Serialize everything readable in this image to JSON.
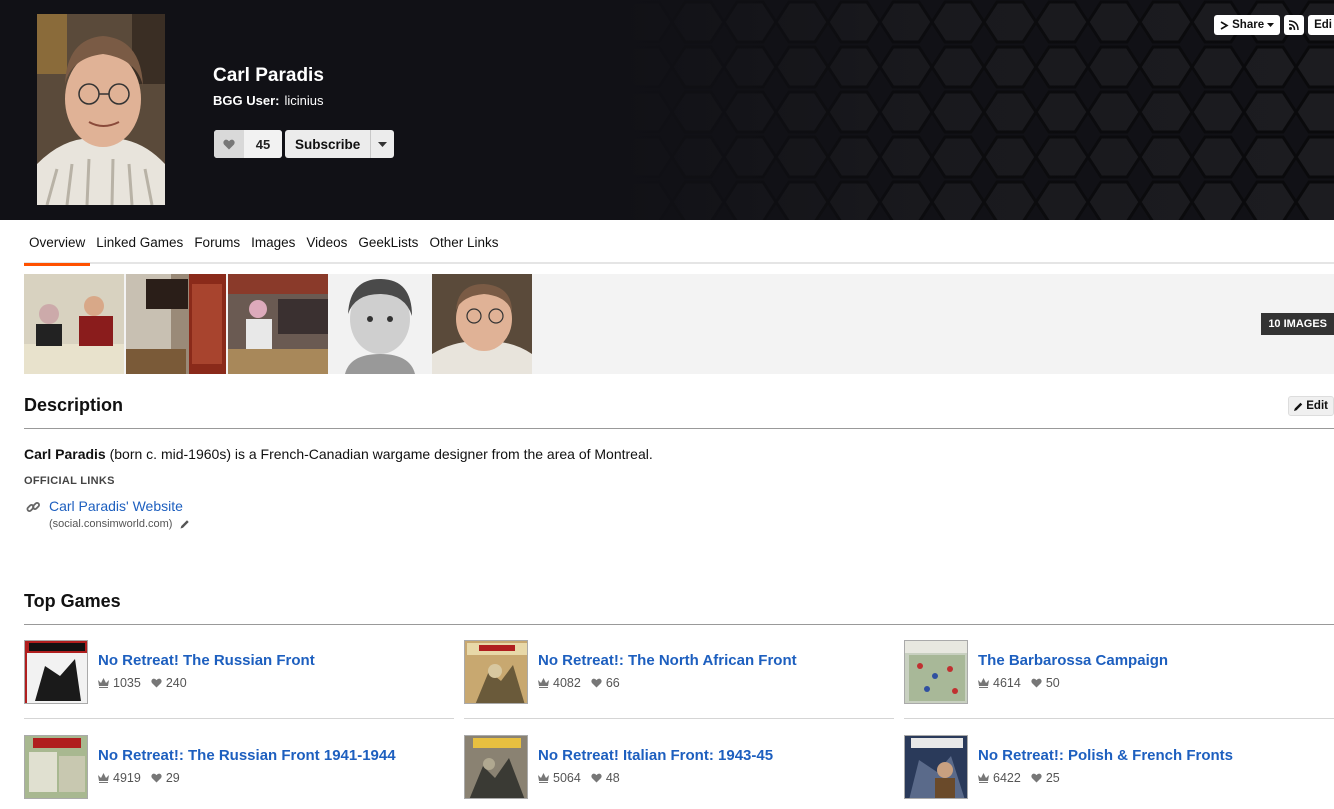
{
  "header": {
    "name": "Carl Paradis",
    "user_label": "BGG User:",
    "username": "licinius",
    "fan_count": "45",
    "subscribe_label": "Subscribe",
    "share_label": "Share",
    "edit_label": "Edi"
  },
  "tabs": [
    "Overview",
    "Linked Games",
    "Forums",
    "Images",
    "Videos",
    "GeekLists",
    "Other Links"
  ],
  "gallery": {
    "count_label": "10 IMAGES"
  },
  "description": {
    "title": "Description",
    "edit_label": "Edit",
    "name_bold": "Carl Paradis",
    "text": " (born c. mid-1960s) is a French-Canadian wargame designer from the area of Montreal.",
    "official_links_label": "OFFICIAL LINKS",
    "link_text": "Carl Paradis' Website",
    "link_domain": "(social.consimworld.com)"
  },
  "top_games": {
    "title": "Top Games",
    "games": [
      {
        "title": "No Retreat! The Russian Front",
        "rank": "1035",
        "fans": "240"
      },
      {
        "title": "No Retreat!: The North African Front",
        "rank": "4082",
        "fans": "66"
      },
      {
        "title": "The Barbarossa Campaign",
        "rank": "4614",
        "fans": "50"
      },
      {
        "title": "No Retreat!: The Russian Front 1941-1944",
        "rank": "4919",
        "fans": "29"
      },
      {
        "title": "No Retreat! Italian Front: 1943-45",
        "rank": "5064",
        "fans": "48"
      },
      {
        "title": "No Retreat!: Polish & French Fronts",
        "rank": "6422",
        "fans": "25"
      }
    ]
  },
  "colors": {
    "accent": "#ff5100",
    "link": "#1d5fbf",
    "header_bg": "#111116"
  }
}
